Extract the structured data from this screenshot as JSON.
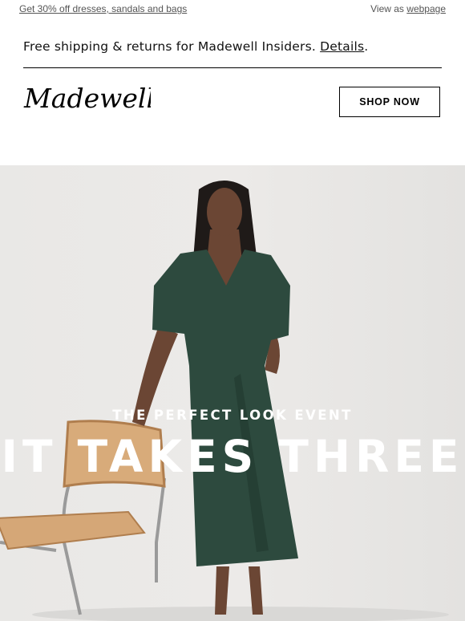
{
  "preheader": {
    "promo_link": "Get 30% off dresses, sandals and bags",
    "view_as": "View as",
    "webpage_link": "webpage"
  },
  "shipping": {
    "text": "Free shipping & returns for Madewell Insiders.",
    "details_link": "Details",
    "period": "."
  },
  "header": {
    "logo_text": "Madewell",
    "shop_button": "SHOP NOW"
  },
  "hero": {
    "eyebrow": "THE PERFECT LOOK EVENT",
    "headline": "IT TAKES THREE",
    "dress_color": "#2d4a3e",
    "text_color": "#ffffff"
  }
}
